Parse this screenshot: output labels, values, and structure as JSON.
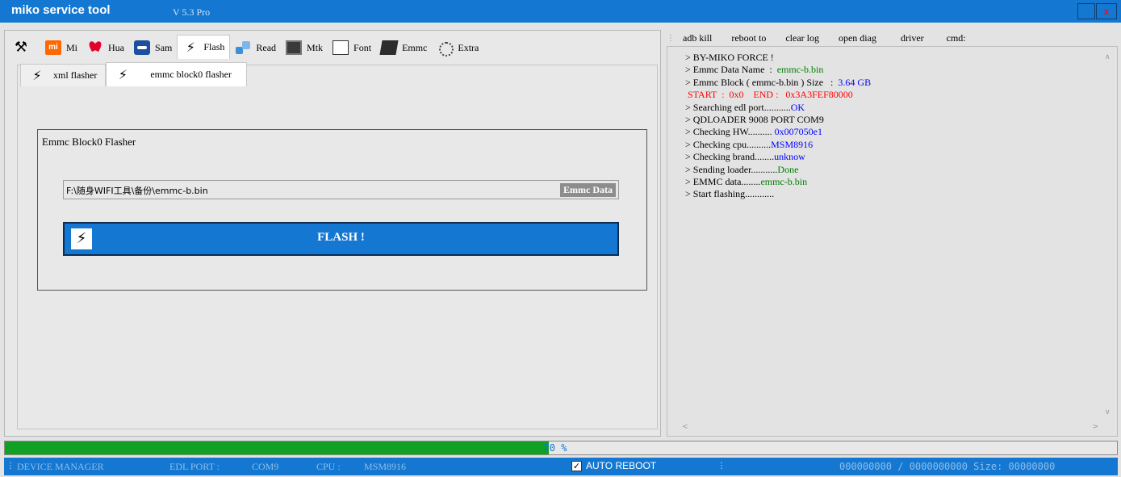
{
  "window": {
    "title": "miko service tool",
    "version": "V 5.3 Pro",
    "close_glyph": "x"
  },
  "main_tabs": [
    {
      "label": "",
      "icon": "tools-icon"
    },
    {
      "label": "Mi",
      "icon": "xiaomi-icon"
    },
    {
      "label": "Hua",
      "icon": "huawei-icon"
    },
    {
      "label": "Sam",
      "icon": "samsung-icon"
    },
    {
      "label": "Flash",
      "icon": "flash-icon",
      "active": true
    },
    {
      "label": "Read",
      "icon": "read-icon"
    },
    {
      "label": "Mtk",
      "icon": "mtk-chip-icon"
    },
    {
      "label": "Font",
      "icon": "font-file-icon"
    },
    {
      "label": "Emmc",
      "icon": "emmc-icon"
    },
    {
      "label": "Extra",
      "icon": "extra-gear-icon"
    }
  ],
  "sub_tabs": [
    {
      "label": "xml flasher",
      "icon": "flash-icon"
    },
    {
      "label": "emmc block0 flasher",
      "icon": "flash-icon",
      "active": true
    }
  ],
  "flasher": {
    "group_title": "Emmc Block0 Flasher",
    "file_path": "F:\\随身WIFI工具\\备份\\emmc-b.bin",
    "file_button": "Emmc Data",
    "flash_button": "FLASH !"
  },
  "log_menu": [
    "adb kill",
    "reboot to",
    "clear log",
    "open diag",
    "driver",
    "cmd:"
  ],
  "log": [
    {
      "parts": [
        {
          "t": "> BY-MIKO FORCE !",
          "c": "#000000"
        }
      ]
    },
    {
      "parts": [
        {
          "t": "> Emmc Data Name  :  ",
          "c": "#000000"
        },
        {
          "t": "emmc-b.bin",
          "c": "#008000"
        }
      ]
    },
    {
      "parts": [
        {
          "t": "> Emmc Block ( emmc-b.bin ) Size   :  ",
          "c": "#000000"
        },
        {
          "t": "3.64 GB",
          "c": "#0000ff"
        }
      ]
    },
    {
      "parts": [
        {
          "t": " START  :  0x0    END :   0x3A3FEF80000",
          "c": "#ff0000"
        }
      ]
    },
    {
      "parts": [
        {
          "t": "> Searching edl port...........",
          "c": "#000000"
        },
        {
          "t": "OK",
          "c": "#0000ff"
        }
      ]
    },
    {
      "parts": [
        {
          "t": "> QDLOADER 9008 PORT COM9",
          "c": "#000000"
        }
      ]
    },
    {
      "parts": [
        {
          "t": "> Checking HW.......... ",
          "c": "#000000"
        },
        {
          "t": "0x007050e1",
          "c": "#0000ff"
        }
      ]
    },
    {
      "parts": [
        {
          "t": "> Checking cpu..........",
          "c": "#000000"
        },
        {
          "t": "MSM8916",
          "c": "#0000ff"
        }
      ]
    },
    {
      "parts": [
        {
          "t": "> Checking brand........",
          "c": "#000000"
        },
        {
          "t": "unknow",
          "c": "#0000ff"
        }
      ]
    },
    {
      "parts": [
        {
          "t": "> Sending loader...........",
          "c": "#000000"
        },
        {
          "t": "Done",
          "c": "#008000"
        }
      ]
    },
    {
      "parts": [
        {
          "t": "> EMMC data........",
          "c": "#000000"
        },
        {
          "t": "emmc-b.bin",
          "c": "#008000"
        }
      ]
    },
    {
      "parts": [
        {
          "t": "> Start flashing............",
          "c": "#000000"
        }
      ]
    }
  ],
  "progress": {
    "percent": 70,
    "label": "70 %"
  },
  "status": {
    "device_manager": "DEVICE MANAGER",
    "edl_port_label": "EDL PORT :",
    "edl_port_value": "COM9",
    "cpu_label": "CPU :",
    "cpu_value": "MSM8916",
    "auto_reboot_label": "AUTO REBOOT",
    "auto_reboot_checked": true,
    "counter": "000000000 / 0000000000 Size: 00000000"
  },
  "colors": {
    "accent": "#1478d2",
    "progress": "#10a024",
    "log_green": "#008000",
    "log_blue": "#0000ff",
    "log_red": "#ff0000"
  }
}
